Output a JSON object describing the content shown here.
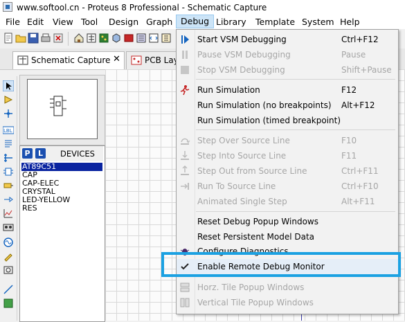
{
  "window": {
    "title": "www.softool.cn - Proteus 8 Professional - Schematic Capture"
  },
  "menubar": {
    "items": [
      "File",
      "Edit",
      "View",
      "Tool",
      "Design",
      "Graph",
      "Debug",
      "Library",
      "Template",
      "System",
      "Help"
    ],
    "active": "Debug"
  },
  "tabs": [
    {
      "label": "Schematic Capture",
      "close": "✕",
      "active": true
    },
    {
      "label": "PCB Layo",
      "active": false
    }
  ],
  "devices_panel": {
    "p_button": "P",
    "l_button": "L",
    "header": "DEVICES",
    "items": [
      "AT89C51",
      "CAP",
      "CAP-ELEC",
      "CRYSTAL",
      "LED-YELLOW",
      "RES"
    ],
    "selected": "AT89C51"
  },
  "debug_menu": {
    "items": [
      {
        "label": "Start VSM Debugging",
        "shortcut": "Ctrl+F12",
        "enabled": true,
        "icon": "play-debug-icon"
      },
      {
        "label": "Pause VSM Debugging",
        "shortcut": "Pause",
        "enabled": false,
        "icon": "pause-icon"
      },
      {
        "label": "Stop VSM Debugging",
        "shortcut": "Shift+Pause",
        "enabled": false,
        "icon": "stop-icon"
      },
      {
        "label": "Run Simulation",
        "shortcut": "F12",
        "enabled": true,
        "icon": "run-simulation-icon"
      },
      {
        "label": "Run Simulation (no breakpoints)",
        "shortcut": "Alt+F12",
        "enabled": true
      },
      {
        "label": "Run Simulation (timed breakpoint)",
        "shortcut": "",
        "enabled": true
      },
      {
        "label": "Step Over Source Line",
        "shortcut": "F10",
        "enabled": false,
        "icon": "step-over-icon"
      },
      {
        "label": "Step Into Source Line",
        "shortcut": "F11",
        "enabled": false,
        "icon": "step-into-icon"
      },
      {
        "label": "Step Out from Source Line",
        "shortcut": "Ctrl+F11",
        "enabled": false,
        "icon": "step-out-icon"
      },
      {
        "label": "Run To Source Line",
        "shortcut": "Ctrl+F10",
        "enabled": false,
        "icon": "run-to-line-icon"
      },
      {
        "label": "Animated Single Step",
        "shortcut": "Alt+F11",
        "enabled": false
      },
      {
        "label": "Reset Debug Popup Windows",
        "shortcut": "",
        "enabled": true
      },
      {
        "label": "Reset Persistent Model Data",
        "shortcut": "",
        "enabled": true
      },
      {
        "label": "Configure Diagnostics...",
        "shortcut": "",
        "enabled": true,
        "icon": "diagnostics-bug-icon"
      },
      {
        "label": "Enable Remote Debug Monitor",
        "shortcut": "",
        "enabled": true,
        "checked": true,
        "icon": "checkmark-icon"
      },
      {
        "label": "Horz. Tile Popup Windows",
        "shortcut": "",
        "enabled": false,
        "icon": "horz-tile-icon"
      },
      {
        "label": "Vertical Tile Popup Windows",
        "shortcut": "",
        "enabled": false,
        "icon": "vert-tile-icon"
      }
    ]
  },
  "colors": {
    "highlight_box": "#1ba1e2",
    "selected_device": "#0a24a0",
    "menu_active": "#cce4f7"
  }
}
